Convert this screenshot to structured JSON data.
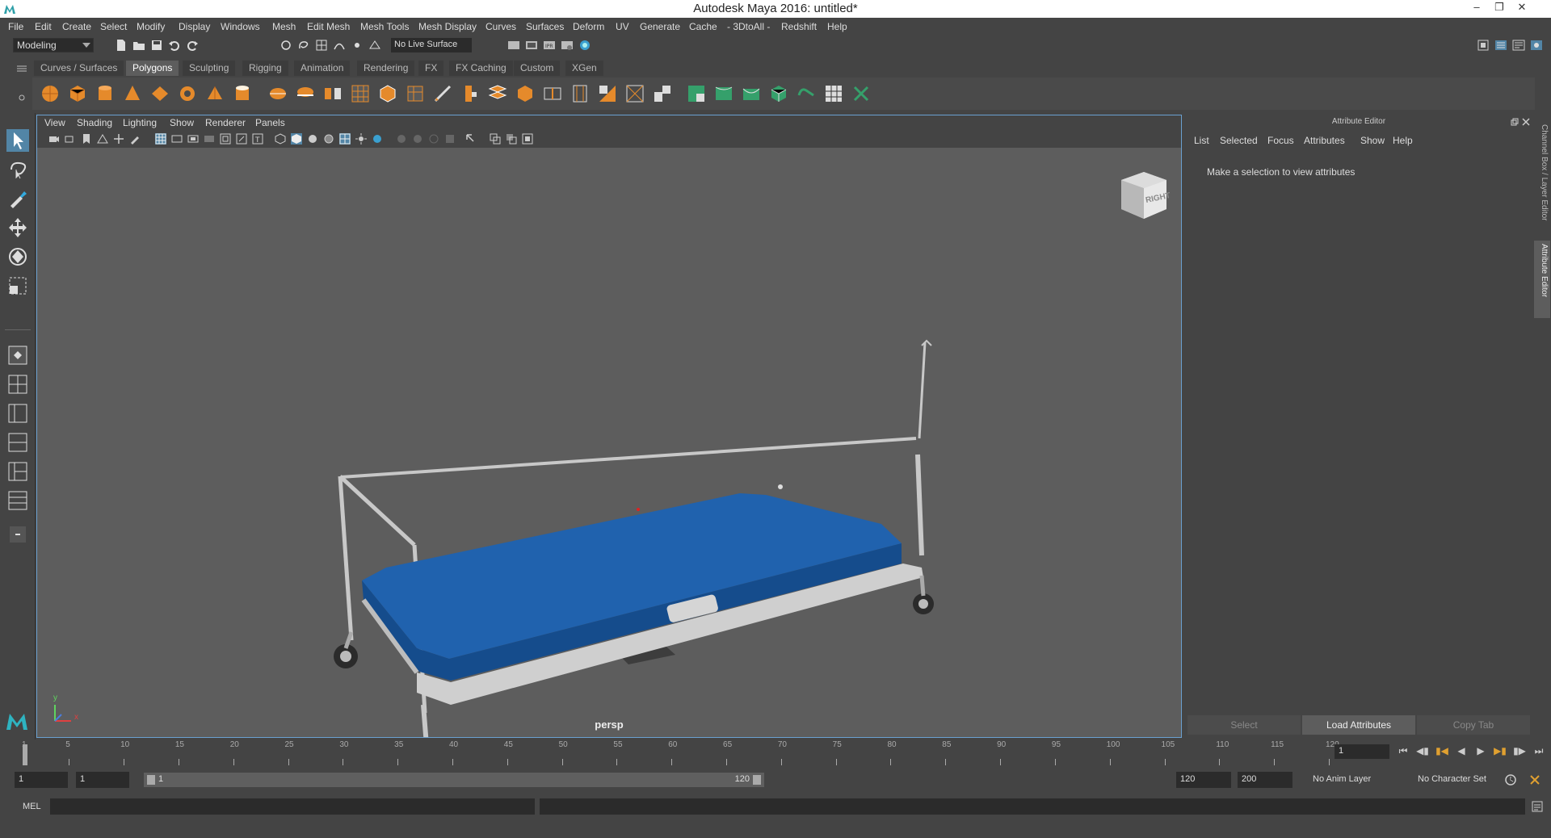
{
  "window": {
    "title": "Autodesk Maya 2016: untitled*"
  },
  "menubar": [
    "File",
    "Edit",
    "Create",
    "Select",
    "Modify",
    "Display",
    "Windows",
    "Mesh",
    "Edit Mesh",
    "Mesh Tools",
    "Mesh Display",
    "Curves",
    "Surfaces",
    "Deform",
    "UV",
    "Generate",
    "Cache",
    "- 3DtoAll -",
    "Redshift",
    "Help"
  ],
  "status_line": {
    "mode": "Modeling",
    "live_surface": "No Live Surface"
  },
  "shelf": {
    "tabs": [
      "Curves / Surfaces",
      "Polygons",
      "Sculpting",
      "Rigging",
      "Animation",
      "Rendering",
      "FX",
      "FX Caching",
      "Custom",
      "XGen"
    ],
    "active_tab": "Polygons"
  },
  "viewport": {
    "menus": [
      "View",
      "Shading",
      "Lighting",
      "Show",
      "Renderer",
      "Panels"
    ],
    "camera_label": "persp",
    "view_cube_label": "RIGHT",
    "axis_x": "x",
    "axis_y": "y"
  },
  "attribute_editor": {
    "title": "Attribute Editor",
    "menus": [
      "List",
      "Selected",
      "Focus",
      "Attributes",
      "Show",
      "Help"
    ],
    "message": "Make a selection to view attributes",
    "buttons": {
      "select": "Select",
      "load": "Load Attributes",
      "copy": "Copy Tab"
    }
  },
  "side_tabs": {
    "channel_box": "Channel Box / Layer Editor",
    "attribute_editor": "Attribute Editor"
  },
  "time_slider": {
    "ticks": [
      "1",
      "5",
      "10",
      "15",
      "20",
      "25",
      "30",
      "35",
      "40",
      "45",
      "50",
      "55",
      "60",
      "65",
      "70",
      "75",
      "80",
      "85",
      "90",
      "95",
      "100",
      "105",
      "110",
      "115",
      "120"
    ],
    "current_frame": "1"
  },
  "range_slider": {
    "start_frame": "1",
    "playback_start": "1",
    "range_start_label": "1",
    "range_end_label": "120",
    "playback_end": "120",
    "end_frame": "200",
    "anim_layer": "No Anim Layer",
    "character_set": "No Character Set"
  },
  "command_line": {
    "label": "MEL"
  },
  "colors": {
    "accent": "#5285a6",
    "mattress": "#1f5fa8",
    "frame": "#c8c8c8"
  }
}
